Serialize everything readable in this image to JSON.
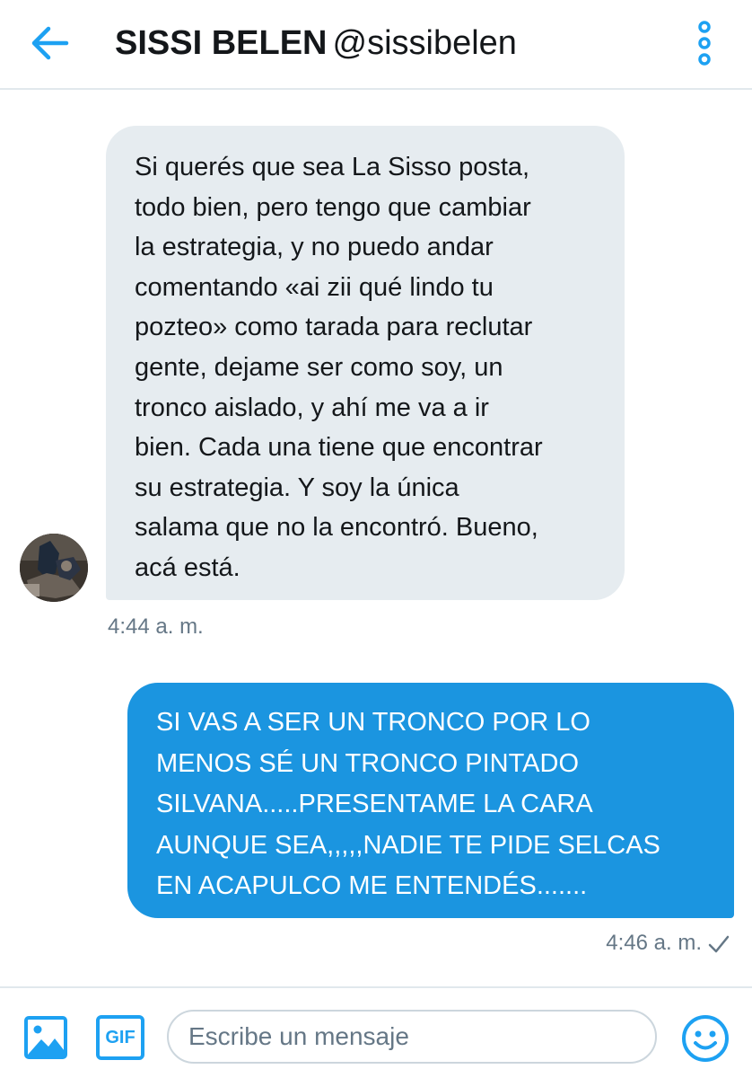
{
  "header": {
    "name": "SISSI BELEN",
    "handle": "@sissibelen",
    "back_icon": "arrow-left-icon",
    "more_icon": "more-vertical-icon"
  },
  "colors": {
    "accent": "#1da1f2",
    "outgoing_bubble": "#1b95e0",
    "incoming_bubble": "#e6ecf0",
    "muted_text": "#657786"
  },
  "messages": [
    {
      "direction": "incoming",
      "lines": [
        "Si querés que sea La Sisso posta,",
        "todo bien, pero tengo que cambiar",
        "la estrategia, y no puedo andar",
        "comentando «ai zii qué lindo tu",
        "pozteo» como tarada para reclutar",
        "gente, dejame ser como soy, un",
        "tronco aislado, y ahí me va a ir",
        "bien. Cada una tiene que encontrar",
        "su estrategia. Y soy la única",
        "salama que no la encontró. Bueno,",
        "acá está."
      ],
      "time": "4:44 a. m."
    },
    {
      "direction": "outgoing",
      "lines": [
        "SI VAS A SER UN TRONCO POR LO",
        "MENOS SÉ UN TRONCO PINTADO",
        "SILVANA.....PRESENTAME LA CARA",
        "AUNQUE SEA,,,,,NADIE TE PIDE SELCAS",
        "EN ACAPULCO ME ENTENDÉS......."
      ],
      "time": "4:46 a. m.",
      "status_icon": "check-icon"
    }
  ],
  "composer": {
    "placeholder": "Escribe un mensaje",
    "gif_label": "GIF",
    "image_icon": "image-icon",
    "emoji_icon": "smiley-icon"
  }
}
